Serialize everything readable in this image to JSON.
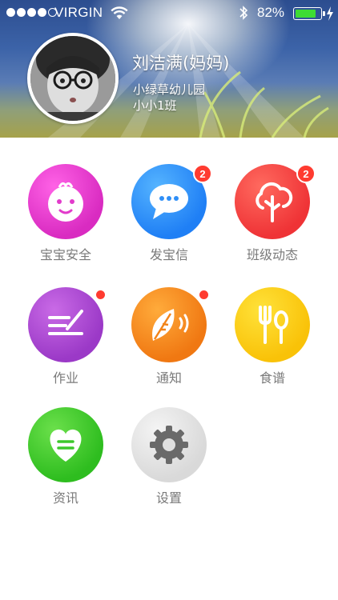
{
  "status_bar": {
    "carrier": "VIRGIN",
    "battery_percent": "82%",
    "battery_level": 0.82,
    "signal_bars": 4,
    "icons": [
      "signal-dots-icon",
      "wifi-icon",
      "bluetooth-icon",
      "battery-icon",
      "charging-bolt-icon"
    ]
  },
  "profile": {
    "name": "刘洁满(妈妈)",
    "school": "小绿草幼儿园",
    "class": "小小1班"
  },
  "menu": [
    {
      "label": "宝宝安全",
      "icon": "baby-face-icon",
      "badge": ""
    },
    {
      "label": "发宝信",
      "icon": "chat-bubble-icon",
      "badge": "2"
    },
    {
      "label": "班级动态",
      "icon": "tree-icon",
      "badge": "2"
    },
    {
      "label": "作业",
      "icon": "pen-lines-icon",
      "badge_dot": true
    },
    {
      "label": "通知",
      "icon": "leaf-sound-icon",
      "badge_dot": true
    },
    {
      "label": "食谱",
      "icon": "fork-spoon-icon",
      "badge": ""
    },
    {
      "label": "资讯",
      "icon": "heart-icon",
      "badge": ""
    },
    {
      "label": "设置",
      "icon": "gear-icon",
      "badge": ""
    }
  ],
  "colors": {
    "pink": "#e23bcb",
    "blue": "#2f8ff7",
    "red": "#f03c3a",
    "purple": "#a747d0",
    "orange": "#f28419",
    "yellow": "#fbcb14",
    "green": "#3cc82b",
    "grey": "#e0e0e0",
    "badge": "#ff3b30",
    "label": "#7a7a7a"
  }
}
